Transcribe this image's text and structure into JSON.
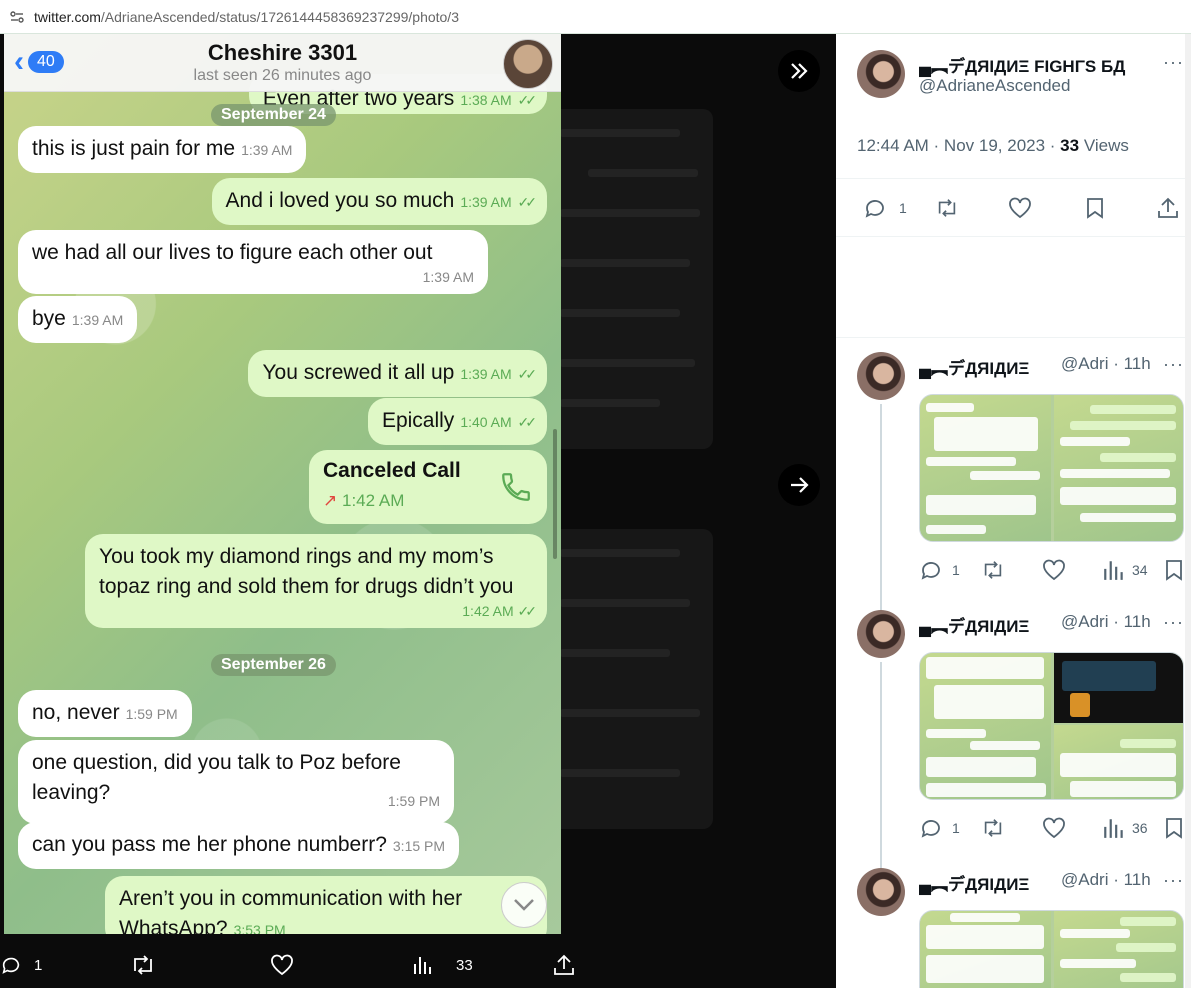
{
  "browser": {
    "url_host": "twitter.com",
    "url_path": "/AdrianeAscended/status/1726144458369237299/photo/3"
  },
  "chat": {
    "back_count": "40",
    "title": "Cheshire 3301",
    "subtitle": "last seen 26 minutes ago",
    "top_partial": {
      "text": "Even after two years",
      "time": "1:38 AM"
    },
    "date1": "September 24",
    "date2": "September 26",
    "messages": [
      {
        "text": "this is just pain for me",
        "time": "1:39 AM"
      },
      {
        "text": "And i loved you so much",
        "time": "1:39 AM"
      },
      {
        "text": "we had all our lives to figure each other out",
        "time": "1:39 AM"
      },
      {
        "text": "bye",
        "time": "1:39 AM"
      },
      {
        "text": "You screwed it all up",
        "time": "1:39 AM"
      },
      {
        "text": "Epically",
        "time": "1:40 AM"
      },
      {
        "text": "You took my diamond rings and my mom’s topaz ring and sold them for drugs didn’t you",
        "time": "1:42 AM"
      },
      {
        "text": "no, never",
        "time": "1:59 PM"
      },
      {
        "text": "one question, did you talk to Poz before leaving?",
        "time": "1:59 PM"
      },
      {
        "text": "can you pass me her phone numberr?",
        "time": "3:15 PM"
      },
      {
        "text": "Aren’t you in communication with her WhatsApp?",
        "time": "3:53 PM"
      }
    ],
    "call": {
      "title": "Canceled Call",
      "time": "1:42 AM",
      "arrow": "↗"
    }
  },
  "viewer_actions": {
    "replies": "1",
    "views": "33"
  },
  "tweet": {
    "name": "▄︻デДЯIДИΞ FIGHΓS БД",
    "handle": "@AdrianeAscended",
    "time": "12:44 AM · Nov 19, 2023 · ",
    "views_count": "33",
    "views_label": " Views",
    "replies": "1"
  },
  "replies": [
    {
      "name": "▄︻デДЯIДИΞ",
      "handle": "@Adri",
      "age": "· 11h",
      "replies": "1",
      "views": "34"
    },
    {
      "name": "▄︻デДЯIДИΞ",
      "handle": "@Adri",
      "age": "· 11h",
      "replies": "1",
      "views": "36"
    },
    {
      "name": "▄︻デДЯIДИΞ",
      "handle": "@Adri",
      "age": "· 11h"
    }
  ],
  "more_glyph": "···",
  "colors": {
    "accent": "#1d9bf0",
    "bubble_out": "#dff8c6",
    "ios_blue": "#2e7cf6"
  }
}
